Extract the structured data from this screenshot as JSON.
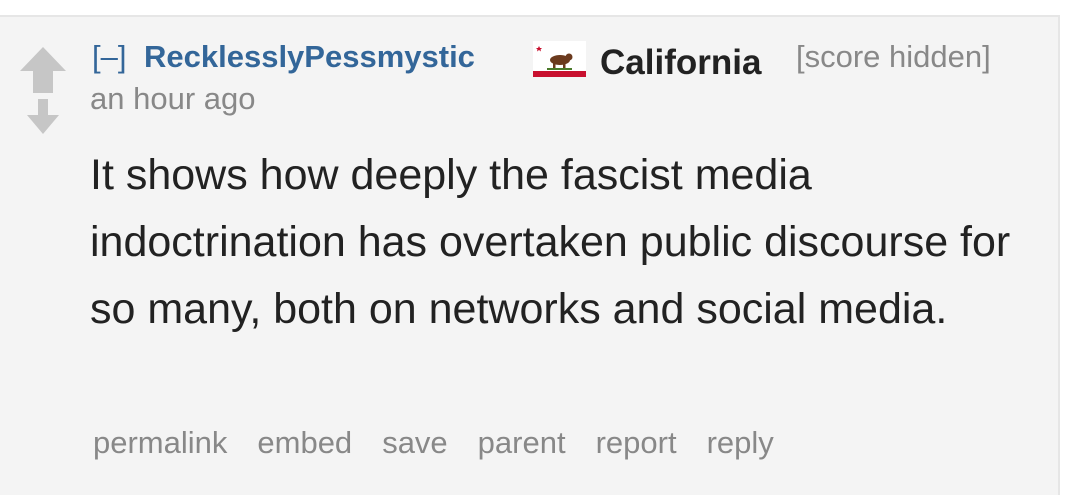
{
  "comment": {
    "expand_label": "[–]",
    "author": "RecklesslyPessmystic",
    "flair": {
      "icon": "california-flag-icon",
      "text": "California"
    },
    "score": "[score hidden]",
    "time": "an hour ago",
    "body": "It shows how deeply the fascist media indoctrination has overtaken public discourse for so many, both on networks and social media.",
    "buttons": {
      "permalink": "permalink",
      "embed": "embed",
      "save": "save",
      "parent": "parent",
      "report": "report",
      "reply": "reply"
    }
  },
  "colors": {
    "background": "#f4f4f4",
    "link": "#336699",
    "muted": "#888888",
    "text": "#222222",
    "arrow": "#c6c6c6"
  }
}
